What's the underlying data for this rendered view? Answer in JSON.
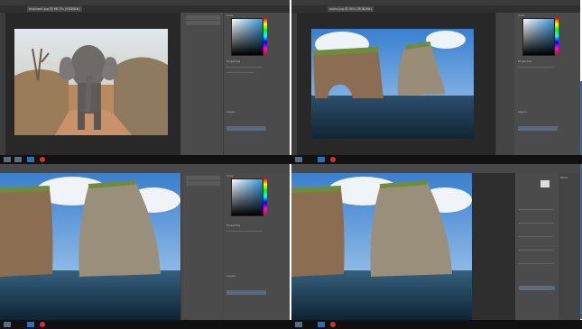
{
  "windows": [
    {
      "tab_label": "elephant.jpg @ 66.7% (RGB/8#)",
      "layer_label": "Background",
      "status": "66.67%"
    },
    {
      "tab_label": "rocks.jpg @ 50% (RGB/8#)",
      "layer_label": "Background",
      "status": "50%"
    },
    {
      "tab_label": "rocks.jpg @ 100% (RGB/8#)",
      "layer_label": "Background",
      "status": "100%"
    },
    {
      "tab_label": "rocks.jpg @ 100% (RGB/8#)",
      "layer_label": "Background",
      "status": "100%"
    }
  ],
  "panels": {
    "color": "Color",
    "swatches": "Swatches",
    "properties": "Properties",
    "layers": "Layers",
    "channels": "Channels",
    "paths": "Paths"
  },
  "colors": {
    "app_bg": "#484848",
    "canvas_bg": "#282828",
    "panel_bg": "#4b4b4b",
    "taskbar": "#111111",
    "accent": "#2b6cb0"
  }
}
